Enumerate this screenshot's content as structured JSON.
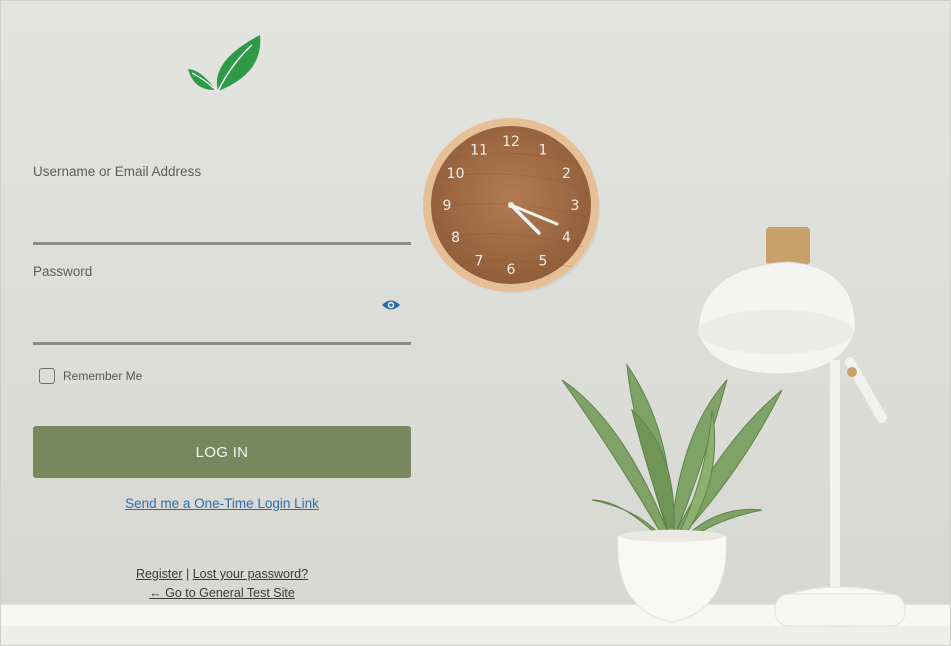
{
  "form": {
    "username_label": "Username or Email Address",
    "username_value": "",
    "password_label": "Password",
    "password_value": "",
    "remember_label": "Remember Me",
    "remember_checked": false,
    "login_button": "LOG IN",
    "one_time_link": "Send me a One-Time Login Link"
  },
  "footer": {
    "register": "Register",
    "separator": "|",
    "lost_password": "Lost your password?",
    "back_link": "← Go to General Test Site"
  },
  "icons": {
    "logo": "leaf-logo-icon",
    "show_password": "eye-icon"
  },
  "clock": {
    "numbers": [
      "12",
      "1",
      "2",
      "3",
      "4",
      "5",
      "6",
      "7",
      "8",
      "9",
      "10",
      "11"
    ]
  },
  "colors": {
    "login_button": "#78875d",
    "link": "#2d6ea8",
    "eye_icon": "#2b6db0",
    "logo_green": "#2e9a48"
  }
}
